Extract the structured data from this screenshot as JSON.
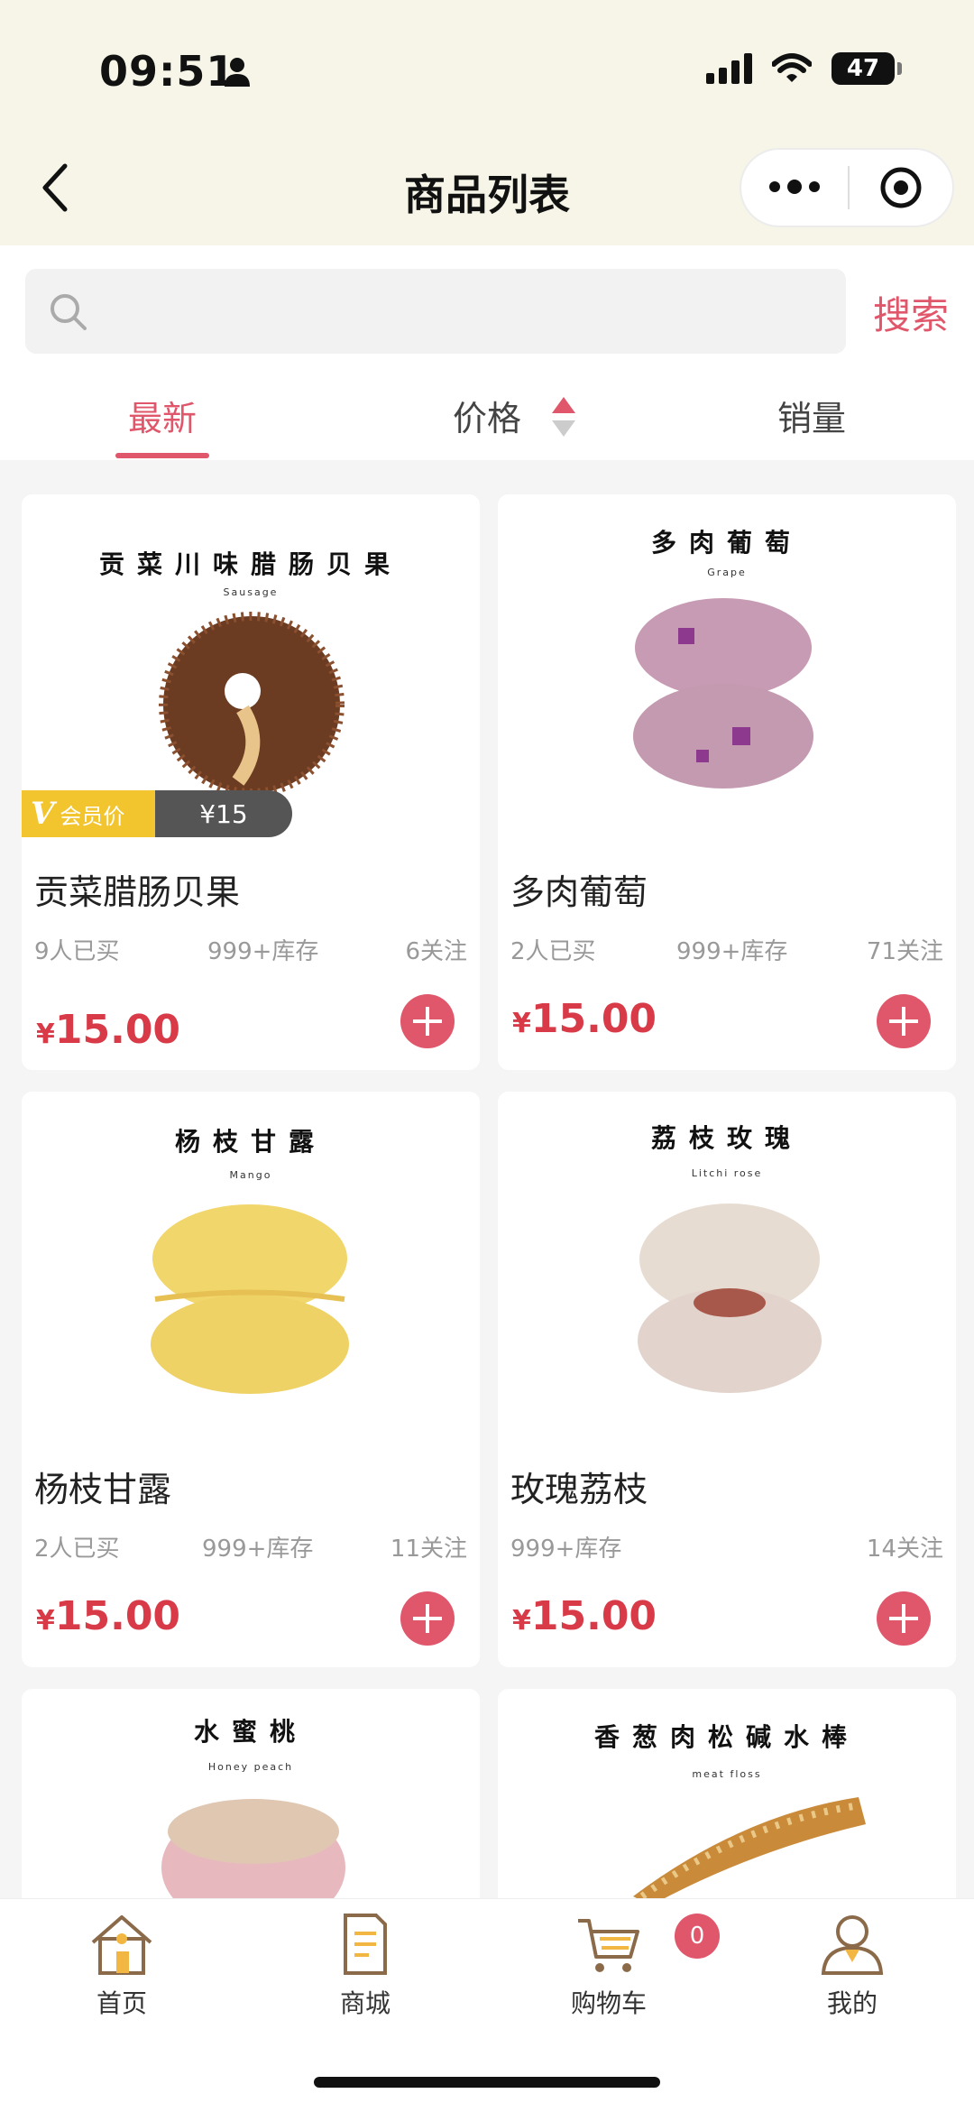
{
  "status": {
    "time": "09:51",
    "battery": "47"
  },
  "nav": {
    "title": "商品列表"
  },
  "search": {
    "placeholder": "",
    "button": "搜索"
  },
  "tabs": [
    {
      "label": "最新",
      "active": true
    },
    {
      "label": "价格",
      "active": false
    },
    {
      "label": "销量",
      "active": false
    }
  ],
  "products": [
    {
      "image_title": "贡菜川味腊肠贝果",
      "image_subtitle": "Sausage",
      "name": "贡菜腊肠贝果",
      "bought": "9人已买",
      "stock": "999+库存",
      "follow": "6关注",
      "currency": "¥",
      "price": "15.00",
      "member_tag": {
        "label": "会员价",
        "price": "¥15"
      }
    },
    {
      "image_title": "多肉葡萄",
      "image_subtitle": "Grape",
      "name": "多肉葡萄",
      "bought": "2人已买",
      "stock": "999+库存",
      "follow": "71关注",
      "currency": "¥",
      "price": "15.00"
    },
    {
      "image_title": "杨枝甘露",
      "image_subtitle": "Mango",
      "name": "杨枝甘露",
      "bought": "2人已买",
      "stock": "999+库存",
      "follow": "11关注",
      "currency": "¥",
      "price": "15.00"
    },
    {
      "image_title": "荔枝玫瑰",
      "image_subtitle": "Litchi rose",
      "name": "玫瑰荔枝",
      "bought": "",
      "stock": "999+库存",
      "follow": "14关注",
      "currency": "¥",
      "price": "15.00"
    },
    {
      "image_title": "水蜜桃",
      "image_subtitle": "Honey peach"
    },
    {
      "image_title": "香葱肉松碱水棒",
      "image_subtitle": "meat floss"
    }
  ],
  "tabbar": {
    "items": [
      {
        "label": "首页",
        "icon": "home-icon"
      },
      {
        "label": "商城",
        "icon": "mall-icon"
      },
      {
        "label": "购物车",
        "icon": "cart-icon"
      },
      {
        "label": "我的",
        "icon": "profile-icon"
      }
    ],
    "cart_badge": "0"
  },
  "colors": {
    "accent": "#e0566a",
    "price": "#d83a48",
    "member_gold": "#f2c52f",
    "header_bg": "#f6f5e7"
  }
}
